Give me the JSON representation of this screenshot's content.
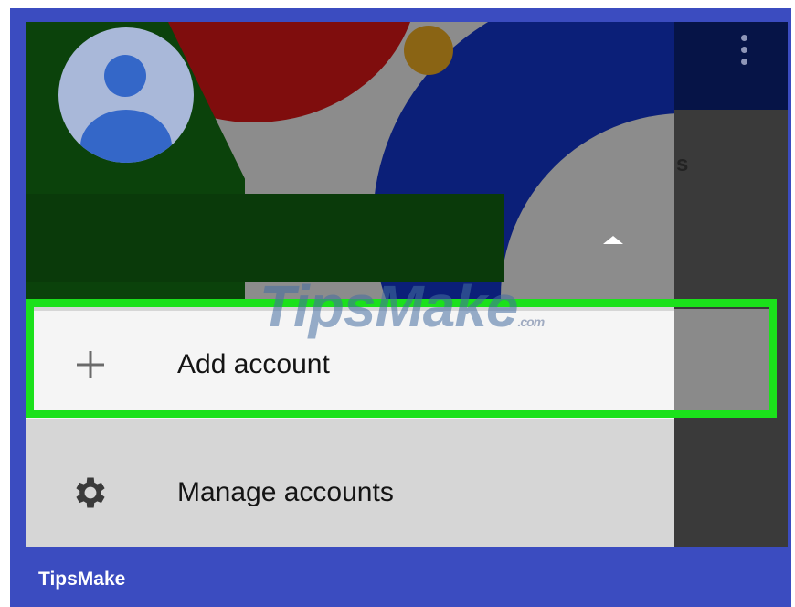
{
  "colors": {
    "frame": "#3b4cc0",
    "highlight": "#1be11b",
    "add_row_bg": "#f5f5f5",
    "manage_row_bg": "#d6d6d6",
    "avatar_bg": "#a9b8d9",
    "avatar_fg": "#3467c8"
  },
  "drawer": {
    "header": {
      "avatar_icon": "account-avatar-icon",
      "toggle_icon": "caret-up-icon"
    },
    "items": [
      {
        "label": "Add account",
        "icon": "plus-icon"
      },
      {
        "label": "Manage accounts",
        "icon": "gear-icon"
      }
    ]
  },
  "background_app": {
    "menu_icon": "overflow-menu-icon",
    "partial_text": "s"
  },
  "watermark": {
    "text": "TipsMake",
    "suffix": ".com"
  },
  "footer": {
    "brand": "TipsMake"
  }
}
